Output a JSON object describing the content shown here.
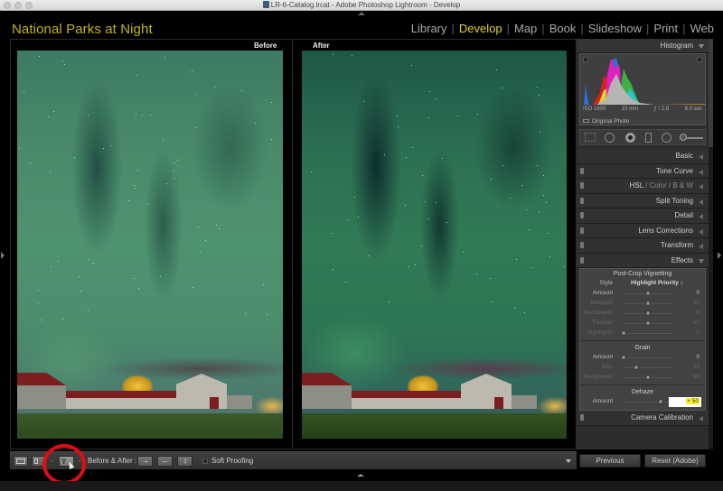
{
  "window": {
    "title": "LR-6-Catalog.lrcat - Adobe Photoshop Lightroom - Develop"
  },
  "identity_plate": "National Parks at Night",
  "modules": [
    {
      "label": "Library",
      "active": false
    },
    {
      "label": "Develop",
      "active": true
    },
    {
      "label": "Map",
      "active": false
    },
    {
      "label": "Book",
      "active": false
    },
    {
      "label": "Slideshow",
      "active": false
    },
    {
      "label": "Print",
      "active": false
    },
    {
      "label": "Web",
      "active": false
    }
  ],
  "module_separator": "|",
  "compare": {
    "before_label": "Before",
    "after_label": "After"
  },
  "toolbar": {
    "view_loupe_icon": "loupe-view-icon",
    "view_before_after_icon": "before-after-view-icon",
    "before_after_label": "Before & After :",
    "soft_proofing_label": "Soft Proofing",
    "soft_proofing_checked": false,
    "dash": "-"
  },
  "panel": {
    "histogram": {
      "title": "Histogram",
      "iso": "ISO 1600",
      "focal_length": "15 mm",
      "aperture": "ƒ / 2.8",
      "shutter": "8.0 sec",
      "original_photo_label": "Original Photo"
    },
    "sections": [
      {
        "label": "Basic",
        "has_switch": false
      },
      {
        "label": "Tone Curve",
        "has_switch": true
      },
      {
        "label_parts": [
          "HSL",
          " / ",
          "Color",
          " / ",
          "B & W"
        ],
        "has_switch": true
      },
      {
        "label": "Split Toning",
        "has_switch": true
      },
      {
        "label": "Detail",
        "has_switch": true
      },
      {
        "label": "Lens Corrections",
        "has_switch": true
      },
      {
        "label": "Transform",
        "has_switch": true
      },
      {
        "label": "Effects",
        "has_switch": true,
        "expanded": true
      }
    ],
    "effects": {
      "vignetting_title": "Post-Crop Vignetting",
      "style_label": "Style",
      "style_value": "Highlight Priority ↕",
      "vignette_sliders": [
        {
          "label": "Amount",
          "value": "0",
          "fraction": 0.5,
          "dim": false
        },
        {
          "label": "Midpoint",
          "value": "50",
          "fraction": 0.5,
          "dim": true
        },
        {
          "label": "Roundness",
          "value": "0",
          "fraction": 0.5,
          "dim": true
        },
        {
          "label": "Feather",
          "value": "50",
          "fraction": 0.5,
          "dim": true
        },
        {
          "label": "Highlights",
          "value": "0",
          "fraction": 0.0,
          "dim": true
        }
      ],
      "grain_title": "Grain",
      "grain_sliders": [
        {
          "label": "Amount",
          "value": "0",
          "fraction": 0.0,
          "dim": false
        },
        {
          "label": "Size",
          "value": "25",
          "fraction": 0.25,
          "dim": true
        },
        {
          "label": "Roughness",
          "value": "50",
          "fraction": 0.5,
          "dim": true
        }
      ],
      "dehaze_title": "Dehaze",
      "dehaze_slider": {
        "label": "Amount",
        "value": "+ 50",
        "fraction": 0.75
      }
    },
    "camera_calibration_label": "Camera Calibration",
    "previous_button": "Previous",
    "reset_button": "Reset (Adobe)"
  },
  "colors": {
    "accent_yellow": "#e6d22a",
    "identity_plate": "#c4b51c",
    "annotation_red": "#e10d13",
    "dehaze_highlight": "#fdf12c"
  }
}
